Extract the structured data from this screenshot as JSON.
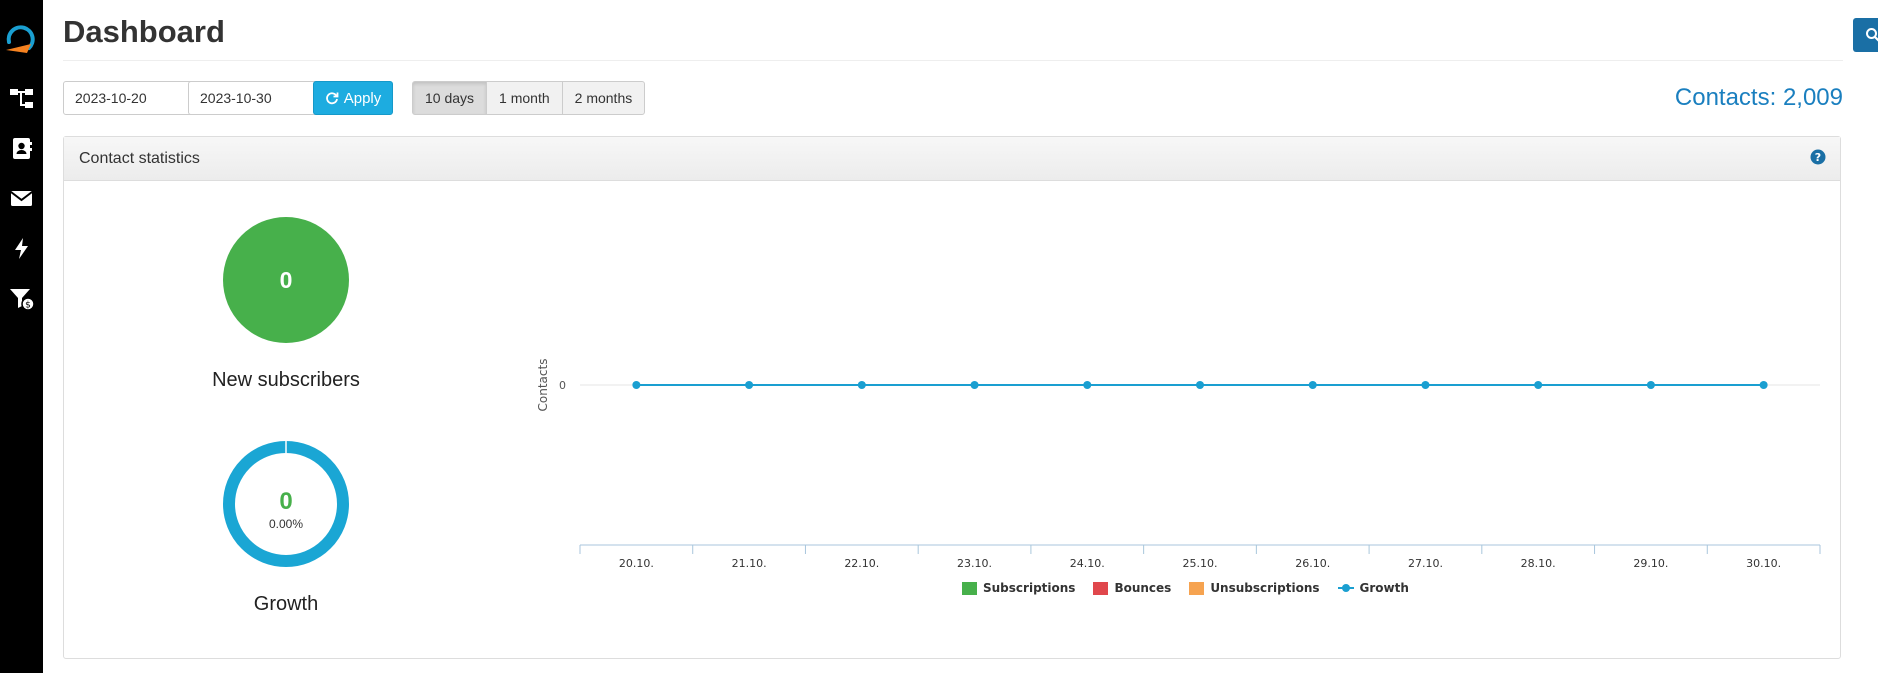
{
  "sidebar": {
    "items": [
      {
        "icon": "sitemap-icon",
        "label": ""
      },
      {
        "icon": "contact-book-icon",
        "label": ""
      },
      {
        "icon": "envelope-icon",
        "label": ""
      },
      {
        "icon": "bolt-icon",
        "label": ""
      },
      {
        "icon": "funnel-dollar-icon",
        "label": ""
      }
    ]
  },
  "header": {
    "title": "Dashboard",
    "search_icon": "search-icon"
  },
  "filters": {
    "date_from": "2023-10-20",
    "date_to": "2023-10-30",
    "apply_label": "Apply",
    "ranges": [
      "10 days",
      "1 month",
      "2 months"
    ],
    "active_range": "10 days"
  },
  "contacts_total": "Contacts: 2,009",
  "panel": {
    "title": "Contact statistics",
    "new_subscribers": {
      "value": "0",
      "label": "New subscribers"
    },
    "growth": {
      "value": "0",
      "percent": "0.00%",
      "label": "Growth"
    }
  },
  "colors": {
    "subscriptions": "#47b04b",
    "bounces": "#e0474c",
    "unsubscriptions": "#f6a350",
    "growth": "#1a9fd1",
    "accent": "#1a7fbf"
  },
  "chart_data": {
    "type": "line",
    "ylabel": "Contacts",
    "categories": [
      "20.10.",
      "21.10.",
      "22.10.",
      "23.10.",
      "24.10.",
      "25.10.",
      "26.10.",
      "27.10.",
      "28.10.",
      "29.10.",
      "30.10."
    ],
    "y_ticks": [
      "0"
    ],
    "series": [
      {
        "name": "Subscriptions",
        "type": "bar",
        "values": [
          0,
          0,
          0,
          0,
          0,
          0,
          0,
          0,
          0,
          0,
          0
        ]
      },
      {
        "name": "Bounces",
        "type": "bar",
        "values": [
          0,
          0,
          0,
          0,
          0,
          0,
          0,
          0,
          0,
          0,
          0
        ]
      },
      {
        "name": "Unsubscriptions",
        "type": "bar",
        "values": [
          0,
          0,
          0,
          0,
          0,
          0,
          0,
          0,
          0,
          0,
          0
        ]
      },
      {
        "name": "Growth",
        "type": "line",
        "values": [
          0,
          0,
          0,
          0,
          0,
          0,
          0,
          0,
          0,
          0,
          0
        ]
      }
    ],
    "legend_position": "bottom"
  }
}
